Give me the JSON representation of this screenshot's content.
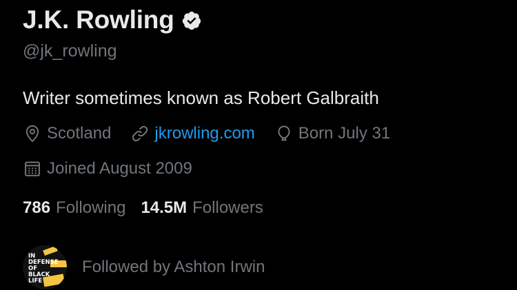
{
  "profile": {
    "display_name": "J.K. Rowling",
    "verified_icon": "verified-badge-icon",
    "handle": "@jk_rowling",
    "bio": "Writer sometimes known as Robert Galbraith",
    "location": "Scotland",
    "website": "jkrowling.com",
    "birthday": "Born July 31",
    "joined": "Joined August 2009"
  },
  "stats": {
    "following_count": "786",
    "following_label": "Following",
    "followers_count": "14.5M",
    "followers_label": "Followers"
  },
  "followed_by": {
    "text": "Followed by Ashton Irwin",
    "avatar_text": "IN\nDEFENSE\nOF\nBLACK\nLIFE"
  },
  "colors": {
    "background": "#000000",
    "primary_text": "#e7e9ea",
    "secondary_text": "#71767b",
    "link": "#1d9bf0",
    "avatar_accent": "#f5c542"
  },
  "icons": {
    "location": "location-pin-icon",
    "website": "link-icon",
    "birthday": "balloon-icon",
    "joined": "calendar-icon"
  }
}
